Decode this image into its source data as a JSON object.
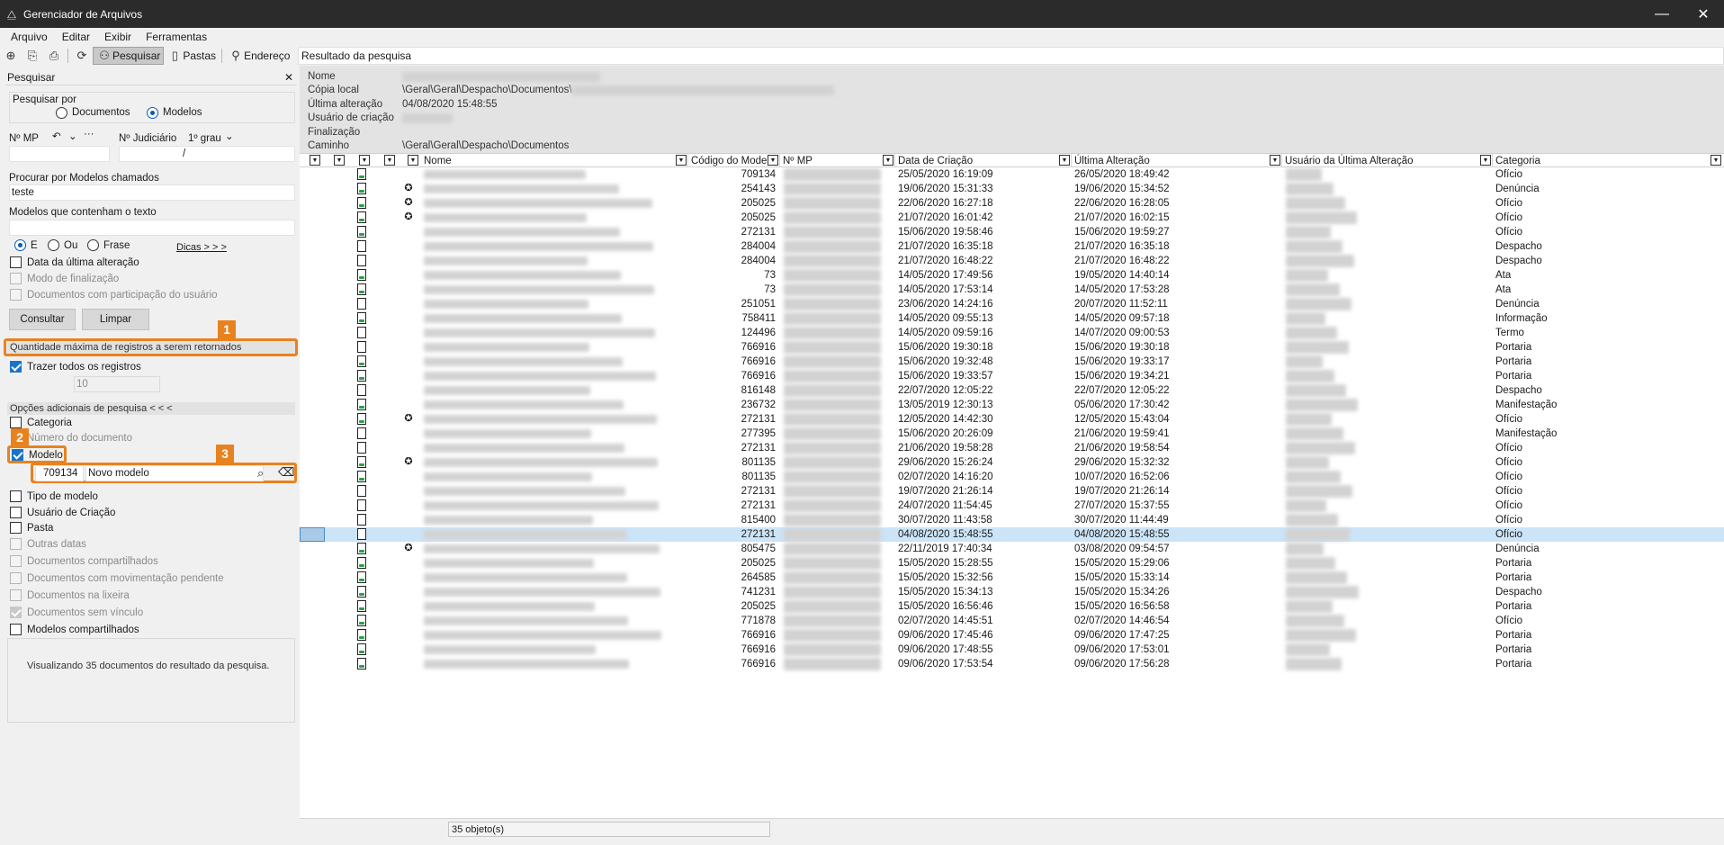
{
  "window": {
    "title": "Gerenciador de Arquivos",
    "close_glyph": "✕",
    "icon": "app-icon"
  },
  "menu": [
    "Arquivo",
    "Editar",
    "Exibir",
    "Ferramentas"
  ],
  "toolbar": {
    "search_label": "Pesquisar",
    "folders_label": "Pastas",
    "address_label": "Endereço",
    "address_value": "Resultado da pesquisa"
  },
  "search_panel": {
    "title": "Pesquisar",
    "close_glyph": "✕",
    "search_by_label": "Pesquisar por",
    "option_documents": "Documentos",
    "option_models": "Modelos",
    "mp_label": "Nº MP",
    "mp_separator": "/",
    "judicial_label": "Nº Judiciário",
    "instance_value": "1º grau",
    "named_label": "Procurar por Modelos chamados",
    "named_value": "teste",
    "containing_label": "Modelos que contenham o texto",
    "containing_value": "",
    "opt_e": "E",
    "opt_ou": "Ou",
    "opt_frase": "Frase",
    "tips_link": "Dicas > > >",
    "last_change_label": "Data da última alteração",
    "finalization_label": "Modo de finalização",
    "participation_label": "Documentos com participação do usuário",
    "consult_btn": "Consultar",
    "clear_btn": "Limpar",
    "max_records_label": "Quantidade máxima de registros a serem retornados",
    "bring_all_label": "Trazer todos os registros",
    "max_value": "10",
    "more_options_label": "Opções adicionais de pesquisa < < <",
    "category_label": "Categoria",
    "doc_number_label": "Número do documento",
    "model_label": "Modelo",
    "model_code": "709134",
    "model_name": "Novo modelo",
    "model_type_label": "Tipo de modelo",
    "created_by_label": "Usuário de Criação",
    "folder_label": "Pasta",
    "other_dates_label": "Outras datas",
    "shared_docs_label": "Documentos compartilhados",
    "pending_docs_label": "Documentos com movimentação pendente",
    "trash_docs_label": "Documentos na lixeira",
    "no_link_docs_label": "Documentos sem vínculo",
    "shared_models_label": "Modelos compartilhados",
    "result_summary": "Visualizando 35 documentos do resultado da pesquisa."
  },
  "callouts": [
    "1",
    "2",
    "3"
  ],
  "details": {
    "name_label": "Nome",
    "local_copy_label": "Cópia local",
    "local_copy_value": "\\Geral\\Geral\\Despacho\\Documentos\\",
    "last_change_label": "Última alteração",
    "last_change_value": "04/08/2020 15:48:55",
    "creator_label": "Usuário de criação",
    "finalization_label": "Finalização",
    "path_label": "Caminho",
    "path_value": "\\Geral\\Geral\\Despacho\\Documentos"
  },
  "columns": {
    "name": "Nome",
    "model_code": "Código do Modelo",
    "mp": "Nº MP",
    "created": "Data de Criação",
    "changed": "Última Alteração",
    "changed_by": "Usuário da Última Alteração",
    "category": "Categoria"
  },
  "rows": [
    {
      "icon": "model-doc",
      "award": false,
      "code": "709134",
      "created": "25/05/2020 16:19:09",
      "changed": "26/05/2020 18:49:42",
      "category": "Ofício"
    },
    {
      "icon": "model-doc",
      "award": true,
      "code": "254143",
      "created": "19/06/2020 15:31:33",
      "changed": "19/06/2020 15:34:52",
      "category": "Denúncia"
    },
    {
      "icon": "model-doc",
      "award": true,
      "code": "205025",
      "created": "22/06/2020 16:27:18",
      "changed": "22/06/2020 16:28:05",
      "category": "Ofício"
    },
    {
      "icon": "model-doc",
      "award": true,
      "code": "205025",
      "created": "21/07/2020 16:01:42",
      "changed": "21/07/2020 16:02:15",
      "category": "Ofício"
    },
    {
      "icon": "model-doc",
      "award": false,
      "code": "272131",
      "created": "15/06/2020 19:58:46",
      "changed": "15/06/2020 19:59:27",
      "category": "Ofício"
    },
    {
      "icon": "doc",
      "award": false,
      "code": "284004",
      "created": "21/07/2020 16:35:18",
      "changed": "21/07/2020 16:35:18",
      "category": "Despacho"
    },
    {
      "icon": "doc",
      "award": false,
      "code": "284004",
      "created": "21/07/2020 16:48:22",
      "changed": "21/07/2020 16:48:22",
      "category": "Despacho"
    },
    {
      "icon": "model-doc",
      "award": false,
      "code": "73",
      "created": "14/05/2020 17:49:56",
      "changed": "19/05/2020 14:40:14",
      "category": "Ata"
    },
    {
      "icon": "model-doc",
      "award": false,
      "code": "73",
      "created": "14/05/2020 17:53:14",
      "changed": "14/05/2020 17:53:28",
      "category": "Ata"
    },
    {
      "icon": "doc",
      "award": false,
      "code": "251051",
      "created": "23/06/2020 14:24:16",
      "changed": "20/07/2020 11:52:11",
      "category": "Denúncia"
    },
    {
      "icon": "model-doc",
      "award": false,
      "code": "758411",
      "created": "14/05/2020 09:55:13",
      "changed": "14/05/2020 09:57:18",
      "category": "Informação"
    },
    {
      "icon": "doc",
      "award": false,
      "code": "124496",
      "created": "14/05/2020 09:59:16",
      "changed": "14/07/2020 09:00:53",
      "category": "Termo"
    },
    {
      "icon": "doc",
      "award": false,
      "code": "766916",
      "created": "15/06/2020 19:30:18",
      "changed": "15/06/2020 19:30:18",
      "category": "Portaria"
    },
    {
      "icon": "model-doc",
      "award": false,
      "code": "766916",
      "created": "15/06/2020 19:32:48",
      "changed": "15/06/2020 19:33:17",
      "category": "Portaria"
    },
    {
      "icon": "model-doc",
      "award": false,
      "code": "766916",
      "created": "15/06/2020 19:33:57",
      "changed": "15/06/2020 19:34:21",
      "category": "Portaria"
    },
    {
      "icon": "doc",
      "award": false,
      "code": "816148",
      "created": "22/07/2020 12:05:22",
      "changed": "22/07/2020 12:05:22",
      "category": "Despacho"
    },
    {
      "icon": "model-doc",
      "award": false,
      "code": "236732",
      "created": "13/05/2019 12:30:13",
      "changed": "05/06/2020 17:30:42",
      "category": "Manifestação"
    },
    {
      "icon": "model-doc",
      "award": true,
      "code": "272131",
      "created": "12/05/2020 14:42:30",
      "changed": "12/05/2020 15:43:04",
      "category": "Ofício"
    },
    {
      "icon": "doc",
      "award": false,
      "code": "277395",
      "created": "15/06/2020 20:26:09",
      "changed": "21/06/2020 19:59:41",
      "category": "Manifestação"
    },
    {
      "icon": "doc",
      "award": false,
      "code": "272131",
      "created": "21/06/2020 19:58:28",
      "changed": "21/06/2020 19:58:54",
      "category": "Ofício"
    },
    {
      "icon": "model-doc",
      "award": true,
      "code": "801135",
      "created": "29/06/2020 15:26:24",
      "changed": "29/06/2020 15:32:32",
      "category": "Ofício"
    },
    {
      "icon": "model-doc",
      "award": false,
      "code": "801135",
      "created": "02/07/2020 14:16:20",
      "changed": "10/07/2020 16:52:06",
      "category": "Ofício"
    },
    {
      "icon": "doc",
      "award": false,
      "code": "272131",
      "created": "19/07/2020 21:26:14",
      "changed": "19/07/2020 21:26:14",
      "category": "Ofício"
    },
    {
      "icon": "doc",
      "award": false,
      "code": "272131",
      "created": "24/07/2020 11:54:45",
      "changed": "27/07/2020 15:37:55",
      "category": "Ofício"
    },
    {
      "icon": "doc",
      "award": false,
      "code": "815400",
      "created": "30/07/2020 11:43:58",
      "changed": "30/07/2020 11:44:49",
      "category": "Ofício"
    },
    {
      "icon": "doc",
      "award": false,
      "code": "272131",
      "created": "04/08/2020 15:48:55",
      "changed": "04/08/2020 15:48:55",
      "category": "Ofício",
      "selected": true
    },
    {
      "icon": "model-doc",
      "award": true,
      "code": "805475",
      "created": "22/11/2019 17:40:34",
      "changed": "03/08/2020 09:54:57",
      "category": "Denúncia"
    },
    {
      "icon": "model-doc",
      "award": false,
      "code": "205025",
      "created": "15/05/2020 15:28:55",
      "changed": "15/05/2020 15:29:06",
      "category": "Portaria"
    },
    {
      "icon": "model-doc",
      "award": false,
      "code": "264585",
      "created": "15/05/2020 15:32:56",
      "changed": "15/05/2020 15:33:14",
      "category": "Portaria"
    },
    {
      "icon": "model-doc",
      "award": false,
      "code": "741231",
      "created": "15/05/2020 15:34:13",
      "changed": "15/05/2020 15:34:26",
      "category": "Despacho"
    },
    {
      "icon": "model-doc",
      "award": false,
      "code": "205025",
      "created": "15/05/2020 16:56:46",
      "changed": "15/05/2020 16:56:58",
      "category": "Portaria"
    },
    {
      "icon": "model-doc",
      "award": false,
      "code": "771878",
      "created": "02/07/2020 14:45:51",
      "changed": "02/07/2020 14:46:54",
      "category": "Ofício"
    },
    {
      "icon": "model-doc",
      "award": false,
      "code": "766916",
      "created": "09/06/2020 17:45:46",
      "changed": "09/06/2020 17:47:25",
      "category": "Portaria"
    },
    {
      "icon": "model-doc",
      "award": false,
      "code": "766916",
      "created": "09/06/2020 17:48:55",
      "changed": "09/06/2020 17:53:01",
      "category": "Portaria"
    },
    {
      "icon": "model-doc",
      "award": false,
      "code": "766916",
      "created": "09/06/2020 17:53:54",
      "changed": "09/06/2020 17:56:28",
      "category": "Portaria"
    }
  ],
  "status": {
    "count": "35 objeto(s)"
  },
  "colors": {
    "accent_orange": "#e8821f",
    "selection": "#cce4f7",
    "checkbox_blue": "#1a73c9"
  }
}
